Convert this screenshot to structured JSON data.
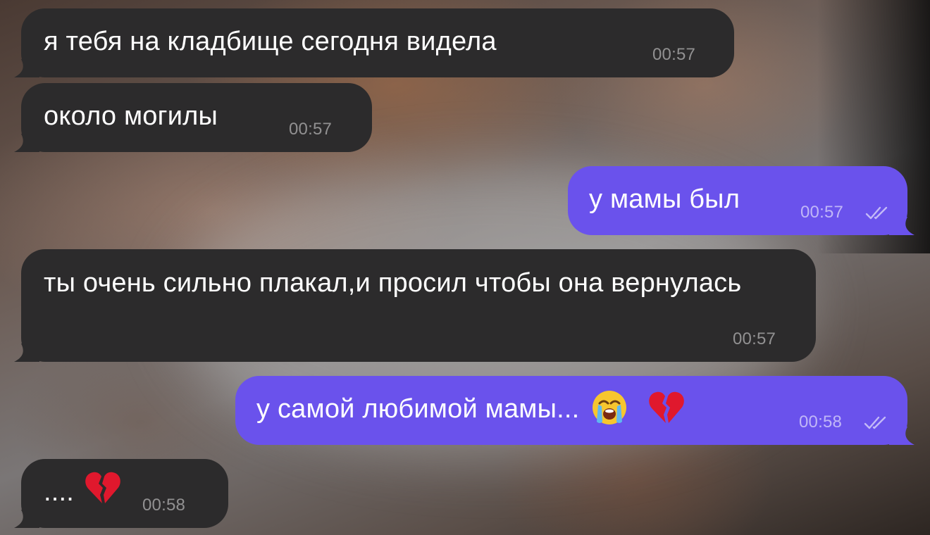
{
  "messages": [
    {
      "direction": "incoming",
      "text": "я тебя на кладбище сегодня видела",
      "time": "00:57"
    },
    {
      "direction": "incoming",
      "text": "около могилы",
      "time": "00:57"
    },
    {
      "direction": "outgoing",
      "text": "у мамы был",
      "time": "00:57",
      "status": "read"
    },
    {
      "direction": "incoming",
      "text": "ты очень сильно плакал,и просил чтобы она вернулась",
      "time": "00:57"
    },
    {
      "direction": "outgoing",
      "text": "у самой любимой мамы...",
      "emojis": [
        "loudly-crying-face-emoji",
        "broken-heart-emoji"
      ],
      "time": "00:58",
      "status": "read"
    },
    {
      "direction": "incoming",
      "text": "....",
      "emojis": [
        "broken-heart-emoji"
      ],
      "time": "00:58"
    }
  ],
  "colors": {
    "incoming_bubble": "#2c2b2c",
    "outgoing_bubble": "#6a52ec",
    "text": "#ffffff"
  },
  "icons": {
    "read_receipt": "double-check-icon",
    "crying": "loudly-crying-face-emoji",
    "broken_heart": "broken-heart-emoji"
  }
}
